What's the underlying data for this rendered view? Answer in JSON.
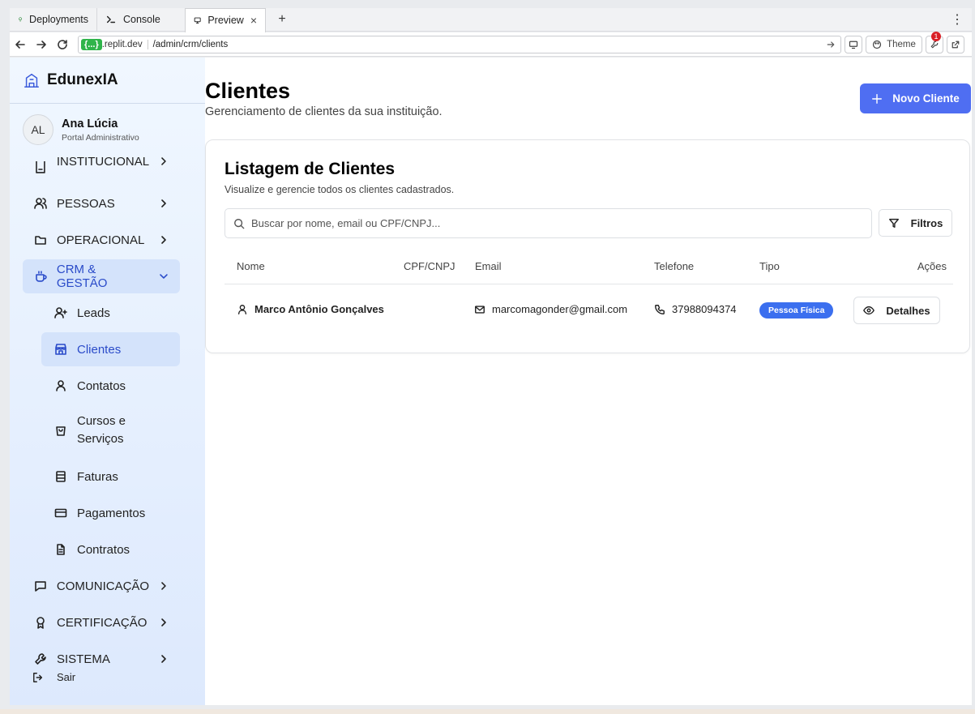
{
  "browser": {
    "tabs": [
      {
        "label": "Deployments",
        "icon": "tree-icon"
      },
      {
        "label": "Console",
        "icon": "terminal-icon"
      },
      {
        "label": "Preview",
        "icon": "monitor-icon",
        "close": "×"
      }
    ],
    "add_tab": "+",
    "more": "⋮",
    "host_badge": "{...}",
    "host_rest": ".replit.dev",
    "url_path": "/admin/crm/clients",
    "theme_label": "Theme",
    "notification_count": "1"
  },
  "sidebar": {
    "brand": "EdunexIA",
    "user": {
      "initials": "AL",
      "name": "Ana Lúcia",
      "role": "Portal Administrativo"
    },
    "items": [
      {
        "label": "INSTITUCIONAL",
        "icon": "building-icon"
      },
      {
        "label": "PESSOAS",
        "icon": "users-icon"
      },
      {
        "label": "OPERACIONAL",
        "icon": "folder-icon"
      },
      {
        "label": "CRM & GESTÃO",
        "icon": "coffee-icon"
      }
    ],
    "sub_items": [
      {
        "label": "Leads",
        "icon": "user-plus-icon"
      },
      {
        "label": "Clientes",
        "icon": "store-icon"
      },
      {
        "label": "Contatos",
        "icon": "user-icon"
      },
      {
        "label": "Cursos e Serviços",
        "icon": "shopping-bag-icon"
      },
      {
        "label": "Faturas",
        "icon": "receipt-icon"
      },
      {
        "label": "Pagamentos",
        "icon": "credit-card-icon"
      },
      {
        "label": "Contratos",
        "icon": "file-text-icon"
      }
    ],
    "bottom_items": [
      {
        "label": "COMUNICAÇÃO",
        "icon": "message-icon"
      },
      {
        "label": "CERTIFICAÇÃO",
        "icon": "award-icon"
      },
      {
        "label": "SISTEMA",
        "icon": "wrench-icon"
      }
    ],
    "logout": "Sair"
  },
  "main": {
    "title": "Clientes",
    "subtitle": "Gerenciamento de clientes da sua instituição.",
    "new_button": "Novo Cliente",
    "card": {
      "title": "Listagem de Clientes",
      "subtitle": "Visualize e gerencie todos os clientes cadastrados.",
      "search_placeholder": "Buscar por nome, email ou CPF/CNPJ...",
      "filters_label": "Filtros",
      "columns": [
        "Nome",
        "CPF/CNPJ",
        "Email",
        "Telefone",
        "Tipo",
        "Ações"
      ],
      "rows": [
        {
          "name": "Marco Antônio Gonçalves",
          "cpf_cnpj": "",
          "email": "marcomagonder@gmail.com",
          "phone": "37988094374",
          "type": "Pessoa Física",
          "action": "Detalhes"
        }
      ]
    }
  },
  "colors": {
    "primary": "#4f6ef2",
    "badge": "#3b6fef",
    "sidebar_active": "#d4e3fb"
  }
}
